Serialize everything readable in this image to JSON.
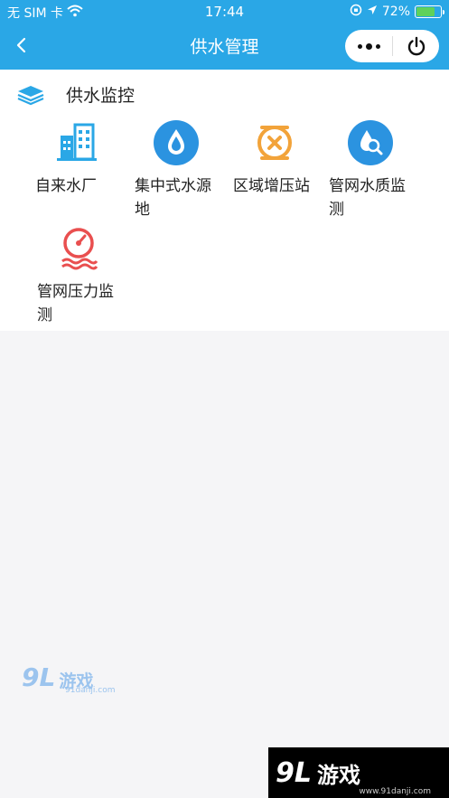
{
  "status": {
    "carrier": "无 SIM 卡",
    "time": "17:44",
    "battery_percent": "72%",
    "battery_level": 0.72
  },
  "navbar": {
    "title": "供水管理"
  },
  "section": {
    "title": "供水监控",
    "items": [
      {
        "label": "自来水厂",
        "icon": "water-plant-building-icon",
        "color": "#2aa7e6"
      },
      {
        "label": "集中式水源地",
        "icon": "water-drop-icon",
        "color": "#2b93e0"
      },
      {
        "label": "区域增压站",
        "icon": "pump-station-icon",
        "color": "#f2a33a"
      },
      {
        "label": "管网水质监测",
        "icon": "water-quality-magnifier-icon",
        "color": "#2b93e0"
      },
      {
        "label": "管网压力监测",
        "icon": "pressure-gauge-icon",
        "color": "#e94f4f"
      }
    ]
  },
  "watermark": {
    "logo": "9L",
    "text": "游戏",
    "url": "91danji.com"
  },
  "corner_logo": {
    "logo": "9L",
    "text": "游戏",
    "url": "www.91danji.com"
  },
  "colors": {
    "primary": "#2aa7e6",
    "background": "#f5f5f7"
  }
}
